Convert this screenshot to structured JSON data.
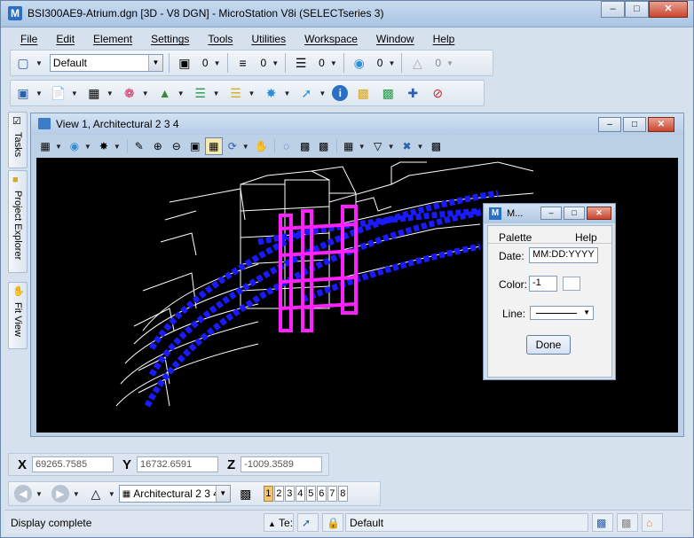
{
  "window": {
    "title": "BSI300AE9-Atrium.dgn [3D - V8 DGN] - MicroStation V8i (SELECTseries 3)",
    "icon": "microstation-logo-icon",
    "buttons": [
      "minimize-icon",
      "maximize-icon",
      "close-icon"
    ]
  },
  "menu": [
    "File",
    "Edit",
    "Element",
    "Settings",
    "Tools",
    "Utilities",
    "Workspace",
    "Window",
    "Help"
  ],
  "attributes_toolbar": {
    "level": "Default",
    "color_value": "0",
    "style_value": "0",
    "weight_value": "0",
    "class_value": "0",
    "transparency_value": "0"
  },
  "side_tabs": [
    "Tasks",
    "Project Explorer",
    "Fit View"
  ],
  "view": {
    "title": "View 1, Architectural 2 3 4",
    "tool_icons": [
      "view-attributes-icon",
      "display-style-icon",
      "lights-icon",
      "update-view-icon",
      "zoom-in-icon",
      "zoom-out-icon",
      "window-area-icon",
      "fit-view-icon",
      "rotate-view-icon",
      "pan-view-icon",
      "view-previous-icon",
      "view-next-icon",
      "copy-view-icon",
      "clip-volume-icon",
      "clip-mask-icon",
      "camera-icon"
    ]
  },
  "dialog": {
    "title": "M...",
    "menu": [
      "Palette",
      "Help"
    ],
    "date_label": "Date:",
    "date_value": "MM:DD:YYYY",
    "color_label": "Color:",
    "color_value": "-1",
    "line_label": "Line:",
    "done_label": "Done"
  },
  "coordinates": {
    "x_label": "X",
    "x_value": "69265.7585",
    "y_label": "Y",
    "y_value": "16732.6591",
    "z_label": "Z",
    "z_value": "-1009.3589"
  },
  "view_bar": {
    "saved_view": "Architectural 2 3 4",
    "view_numbers": [
      "1",
      "2",
      "3",
      "4",
      "5",
      "6",
      "7",
      "8"
    ],
    "active_view": "1"
  },
  "status": {
    "message": "Display complete",
    "text_field": "Te:",
    "level": "Default"
  },
  "colors": {
    "canvas_background": "#000000",
    "wireframe": "#ffffff",
    "beam_blue": "#1a1aff",
    "highlight_magenta": "#ff22ff",
    "chrome_blue": "#d6e1ee"
  }
}
